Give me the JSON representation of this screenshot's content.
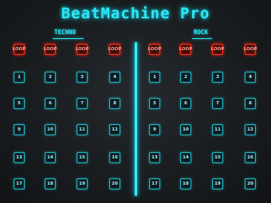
{
  "app": {
    "title": "BeatMachine Pro"
  },
  "sections": [
    {
      "label": "TECHNO",
      "loops": [
        "LOOP",
        "LOOP",
        "LOOP",
        "LOOP"
      ],
      "pads": [
        "1",
        "2",
        "3",
        "4",
        "5",
        "6",
        "7",
        "8",
        "9",
        "10",
        "11",
        "12",
        "13",
        "14",
        "15",
        "16",
        "17",
        "18",
        "19",
        "20"
      ]
    },
    {
      "label": "ROCK",
      "loops": [
        "LOOP",
        "LOOP",
        "LOOP",
        "LOOP"
      ],
      "pads": [
        "1",
        "2",
        "3",
        "4",
        "5",
        "6",
        "7",
        "8",
        "9",
        "10",
        "11",
        "12",
        "13",
        "14",
        "15",
        "16",
        "17",
        "18",
        "19",
        "20"
      ]
    }
  ],
  "colors": {
    "accent_cyan": "#2ee8f7",
    "loop_red": "#ff2a1c",
    "background": "#1a1d20"
  }
}
